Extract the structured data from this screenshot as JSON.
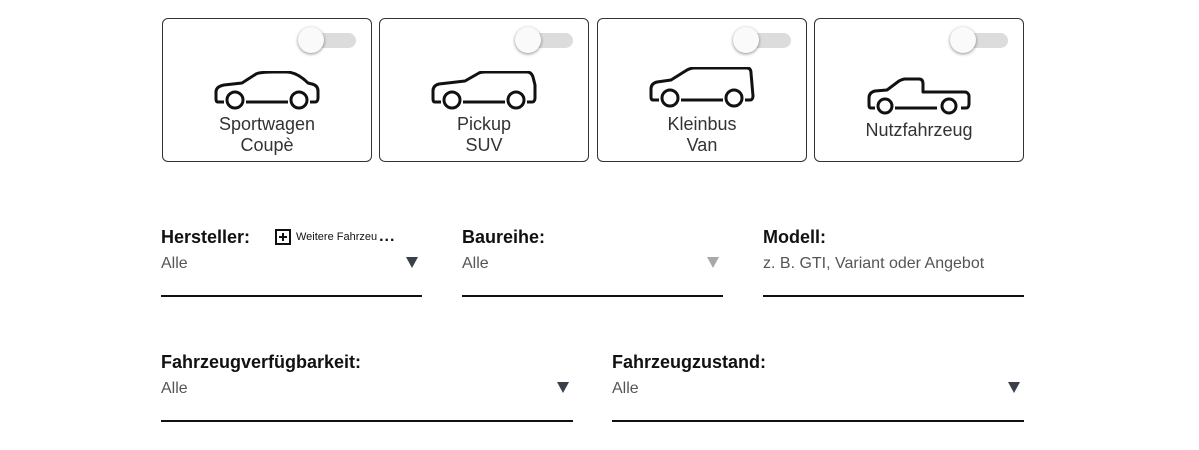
{
  "vehicle_types": [
    {
      "lines": [
        "Sportwagen",
        "Coupè"
      ],
      "icon": "sports-car-icon",
      "active": false
    },
    {
      "lines": [
        "Pickup",
        "SUV"
      ],
      "icon": "suv-icon",
      "active": false
    },
    {
      "lines": [
        "Kleinbus",
        "Van"
      ],
      "icon": "van-icon",
      "active": false
    },
    {
      "lines": [
        "Nutzfahrzeug"
      ],
      "icon": "pickup-truck-icon",
      "active": false
    }
  ],
  "filters": {
    "hersteller": {
      "label": "Hersteller:",
      "value": "Alle",
      "more_link": "Weitere Fahrzeu",
      "more_ellipsis": "..."
    },
    "baureihe": {
      "label": "Baureihe:",
      "value": "Alle",
      "disabled": true
    },
    "modell": {
      "label": "Modell:",
      "placeholder": "z. B. GTI, Variant oder Angebot"
    },
    "verfuegbarkeit": {
      "label": "Fahrzeugverfügbarkeit:",
      "value": "Alle"
    },
    "zustand": {
      "label": "Fahrzeugzustand:",
      "value": "Alle"
    }
  },
  "colors": {
    "border": "#333333",
    "toggle_track": "#dcdcdc",
    "arrow": "#3a3f4a",
    "arrow_disabled": "#a8a8a8"
  }
}
